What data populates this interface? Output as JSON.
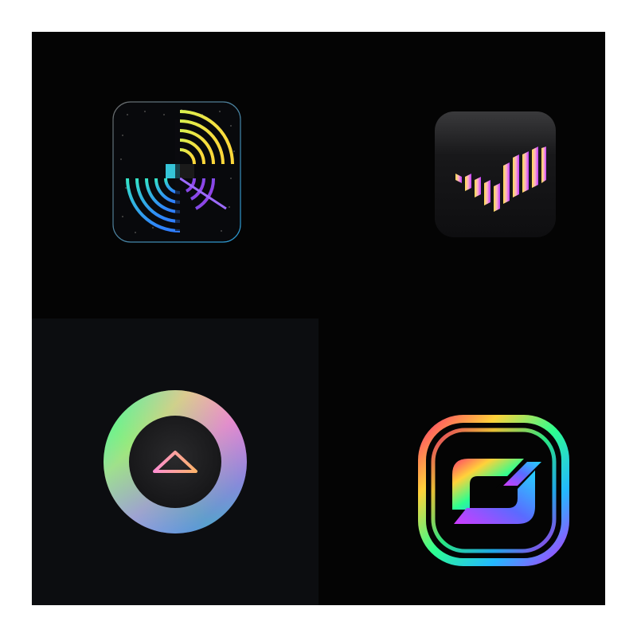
{
  "sheet": {
    "icons": [
      {
        "name": "radar-arcs-icon"
      },
      {
        "name": "bar-signal-icon"
      },
      {
        "name": "up-arrow-ring-icon"
      },
      {
        "name": "interlocked-s-icon"
      }
    ]
  },
  "colors": {
    "sheet_background": "#040404",
    "panel_background": "#0c0d10",
    "gradient": [
      "#ffe14d",
      "#ff4fd8",
      "#8a4dff",
      "#23d5ff",
      "#2dff8f"
    ]
  }
}
